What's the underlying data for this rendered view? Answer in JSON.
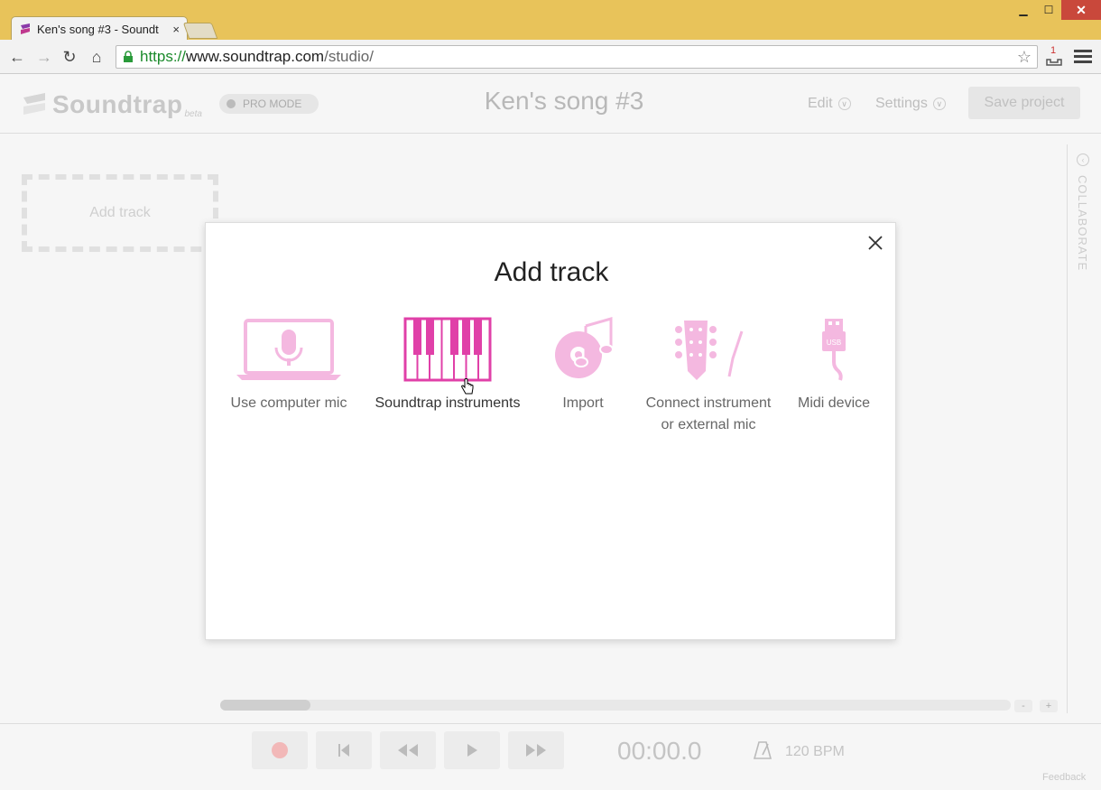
{
  "browser": {
    "tab_title": "Ken's song #3 - Soundt",
    "tab_close": "×",
    "url_scheme": "https://",
    "url_host": "www.soundtrap.com",
    "url_path": "/studio/",
    "ext_badge": "1"
  },
  "header": {
    "logo_text": "Soundtrap",
    "logo_beta": "beta",
    "pro_mode": "PRO MODE",
    "song_title": "Ken's song #3",
    "edit_label": "Edit",
    "settings_label": "Settings",
    "save_label": "Save project"
  },
  "workspace": {
    "add_track_label": "Add track",
    "collaborate_label": "COLLABORATE",
    "zoom_out": "-",
    "zoom_in": "+"
  },
  "transport": {
    "time": "00:00.0",
    "bpm": "120 BPM",
    "feedback": "Feedback"
  },
  "modal": {
    "title": "Add track",
    "options": [
      {
        "label": "Use computer mic",
        "icon": "laptop-mic-icon"
      },
      {
        "label": "Soundtrap instruments",
        "icon": "piano-keys-icon"
      },
      {
        "label": "Import",
        "icon": "import-music-icon"
      },
      {
        "label_line1": "Connect instrument",
        "label_line2": "or external mic",
        "icon": "guitar-headstock-icon"
      },
      {
        "label": "Midi device",
        "icon": "usb-plug-icon"
      }
    ]
  },
  "colors": {
    "accent_pink": "#e040a8",
    "light_pink": "#f4b8e0",
    "frame": "#e8c35a"
  }
}
